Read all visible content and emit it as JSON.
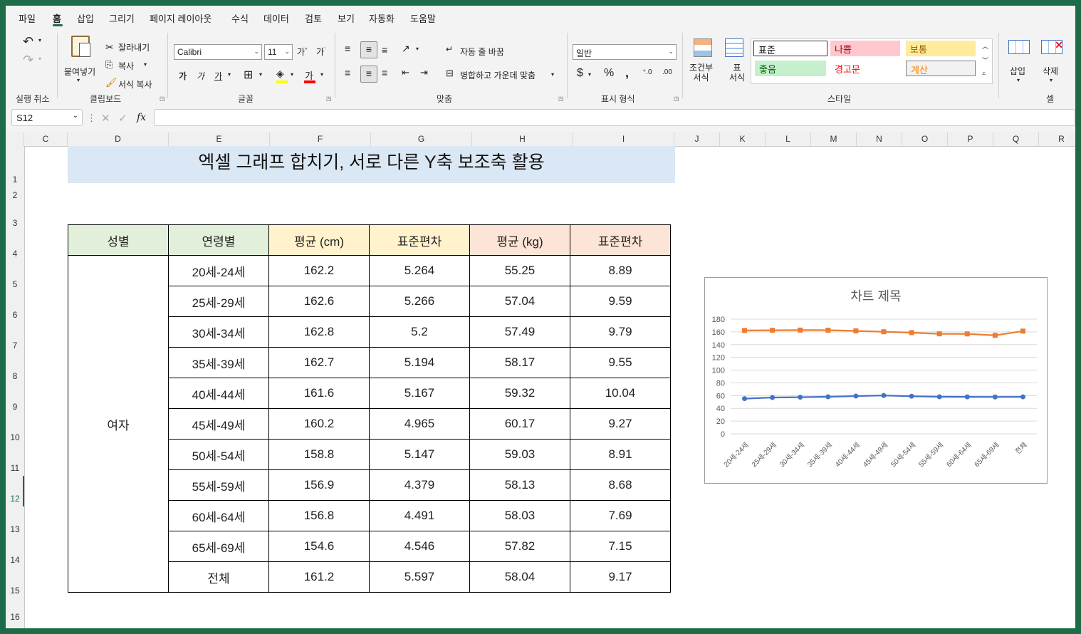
{
  "menu": [
    "파일",
    "홈",
    "삽입",
    "그리기",
    "페이지 레이아웃",
    "수식",
    "데이터",
    "검토",
    "보기",
    "자동화",
    "도움말"
  ],
  "ribbon": {
    "undo_group": "실행 취소",
    "paste": "붙여넣기",
    "cut": "잘라내기",
    "copy": "복사",
    "format_painter": "서식 복사",
    "clipboard_group": "클립보드",
    "font_name": "Calibri",
    "font_size": "11",
    "font_group": "글꼴",
    "wrap_text": "자동 줄 바꿈",
    "merge_center": "병합하고 가운데 맞춤",
    "align_group": "맞춤",
    "number_format": "일반",
    "number_group": "표시 형식",
    "cond_format": "조건부\n서식",
    "table_format": "표\n서식",
    "styles": [
      "표준",
      "나쁨",
      "보통",
      "좋음",
      "경고문",
      "계산"
    ],
    "styles_group": "스타일",
    "insert": "삽입",
    "delete": "삭제",
    "cells_group": "셀"
  },
  "formula_bar": {
    "name_box": "S12",
    "fx": "fx",
    "value": ""
  },
  "columns": [
    "C",
    "D",
    "E",
    "F",
    "G",
    "H",
    "I",
    "J",
    "K",
    "L",
    "M",
    "N",
    "O",
    "P",
    "Q",
    "R"
  ],
  "rows": [
    "1",
    "2",
    "3",
    "4",
    "5",
    "6",
    "7",
    "8",
    "9",
    "10",
    "11",
    "12",
    "13",
    "14",
    "15",
    "16"
  ],
  "selected_row": "12",
  "sheet_title": "엑셀 그래프 합치기, 서로 다른 Y축 보조축 활용",
  "table": {
    "headers": [
      "성별",
      "연령별",
      "평균 (cm)",
      "표준편차",
      "평균 (kg)",
      "표준편차"
    ],
    "gender": "여자",
    "rows": [
      [
        "20세-24세",
        "162.2",
        "5.264",
        "55.25",
        "8.89"
      ],
      [
        "25세-29세",
        "162.6",
        "5.266",
        "57.04",
        "9.59"
      ],
      [
        "30세-34세",
        "162.8",
        "5.2",
        "57.49",
        "9.79"
      ],
      [
        "35세-39세",
        "162.7",
        "5.194",
        "58.17",
        "9.55"
      ],
      [
        "40세-44세",
        "161.6",
        "5.167",
        "59.32",
        "10.04"
      ],
      [
        "45세-49세",
        "160.2",
        "4.965",
        "60.17",
        "9.27"
      ],
      [
        "50세-54세",
        "158.8",
        "5.147",
        "59.03",
        "8.91"
      ],
      [
        "55세-59세",
        "156.9",
        "4.379",
        "58.13",
        "8.68"
      ],
      [
        "60세-64세",
        "156.8",
        "4.491",
        "58.03",
        "7.69"
      ],
      [
        "65세-69세",
        "154.6",
        "4.546",
        "57.82",
        "7.15"
      ],
      [
        "전체",
        "161.2",
        "5.597",
        "58.04",
        "9.17"
      ]
    ]
  },
  "colors": {
    "accent": "#1e6b47",
    "series_height": "#ed7d31",
    "series_weight": "#4472c4"
  },
  "chart_data": {
    "type": "line",
    "title": "차트 제목",
    "categories": [
      "20세-24세",
      "25세-29세",
      "30세-34세",
      "35세-39세",
      "40세-44세",
      "45세-49세",
      "50세-54세",
      "55세-59세",
      "60세-64세",
      "65세-69세",
      "전체"
    ],
    "series": [
      {
        "values": [
          162.2,
          162.6,
          162.8,
          162.7,
          161.6,
          160.2,
          158.8,
          156.9,
          156.8,
          154.6,
          161.2
        ],
        "color": "#ed7d31",
        "marker": "square"
      },
      {
        "values": [
          55.25,
          57.04,
          57.49,
          58.17,
          59.32,
          60.17,
          59.03,
          58.13,
          58.03,
          57.82,
          58.04
        ],
        "color": "#4472c4",
        "marker": "circle"
      }
    ],
    "yticks": [
      "0",
      "20",
      "40",
      "60",
      "80",
      "100",
      "120",
      "140",
      "160",
      "180"
    ],
    "ylim": [
      0,
      180
    ],
    "grid": true
  }
}
